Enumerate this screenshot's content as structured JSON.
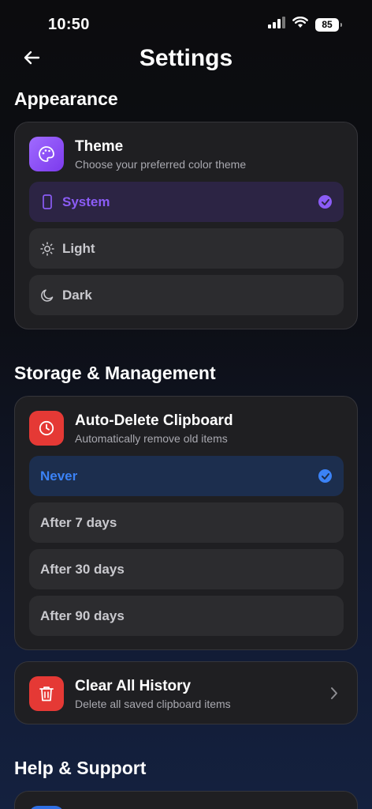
{
  "status_bar": {
    "time": "10:50",
    "battery": "85"
  },
  "header": {
    "title": "Settings"
  },
  "appearance": {
    "section_title": "Appearance",
    "card": {
      "title": "Theme",
      "subtitle": "Choose your preferred color theme",
      "icon": "palette-icon",
      "icon_color": "#8b5cf6"
    },
    "options": [
      {
        "label": "System",
        "icon": "phone-icon",
        "selected": true
      },
      {
        "label": "Light",
        "icon": "sun-icon",
        "selected": false
      },
      {
        "label": "Dark",
        "icon": "moon-icon",
        "selected": false
      }
    ]
  },
  "storage": {
    "section_title": "Storage & Management",
    "auto_delete": {
      "title": "Auto-Delete Clipboard",
      "subtitle": "Automatically remove old items",
      "icon": "clock-icon",
      "icon_color": "#e53935",
      "options": [
        {
          "label": "Never",
          "selected": true
        },
        {
          "label": "After 7 days",
          "selected": false
        },
        {
          "label": "After 30 days",
          "selected": false
        },
        {
          "label": "After 90 days",
          "selected": false
        }
      ]
    },
    "clear_history": {
      "title": "Clear All History",
      "subtitle": "Delete all saved clipboard items",
      "icon": "trash-icon",
      "icon_color": "#e53935"
    }
  },
  "help": {
    "section_title": "Help & Support"
  },
  "colors": {
    "accent_purple": "#8b5cf6",
    "accent_blue": "#3b82f6",
    "danger": "#e53935",
    "card_bg": "#1f1f22"
  }
}
